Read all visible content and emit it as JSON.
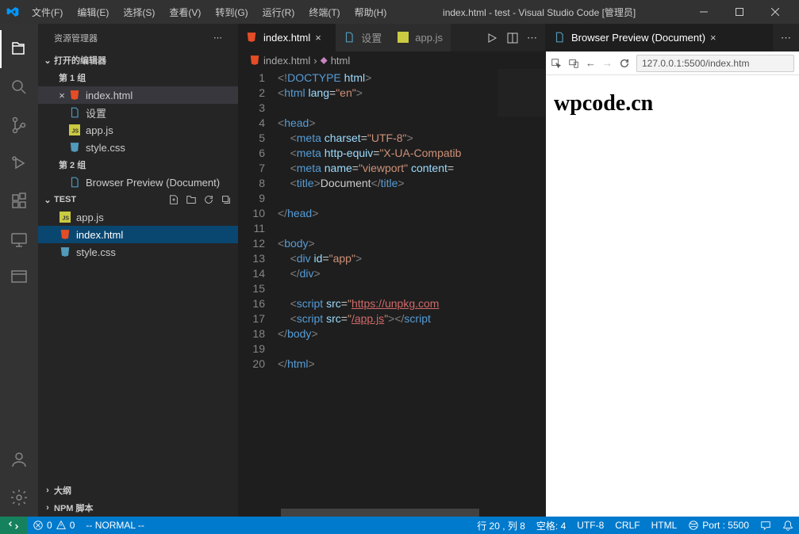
{
  "titlebar": {
    "menu": [
      "文件(F)",
      "编辑(E)",
      "选择(S)",
      "查看(V)",
      "转到(G)",
      "运行(R)",
      "终端(T)",
      "帮助(H)"
    ],
    "title": "index.html - test - Visual Studio Code [管理员]"
  },
  "sidebar": {
    "title": "资源管理器",
    "open_editors": "打开的编辑器",
    "group1": "第 1 组",
    "group2": "第 2 组",
    "files_g1": [
      {
        "name": "index.html",
        "icon": "html",
        "close": true
      },
      {
        "name": "设置",
        "icon": "file"
      },
      {
        "name": "app.js",
        "icon": "js"
      },
      {
        "name": "style.css",
        "icon": "css"
      }
    ],
    "files_g2": [
      {
        "name": "Browser Preview (Document)",
        "icon": "file"
      }
    ],
    "project": "TEST",
    "project_files": [
      {
        "name": "app.js",
        "icon": "js"
      },
      {
        "name": "index.html",
        "icon": "html",
        "selected": true
      },
      {
        "name": "style.css",
        "icon": "css"
      }
    ],
    "outline": "大纲",
    "npm": "NPM 脚本"
  },
  "tabs": {
    "t1": "index.html",
    "t2": "设置",
    "t3": "app.js",
    "preview": "Browser Preview (Document)"
  },
  "breadcrumb": {
    "file": "index.html",
    "path": "html"
  },
  "code": {
    "lines": 20,
    "l1": {
      "a": "<!",
      "b": "DOCTYPE",
      "c": " html",
      "d": ">"
    },
    "l2": {
      "a": "<",
      "b": "html",
      "c": " lang",
      "d": "=",
      "e": "\"en\"",
      "f": ">"
    },
    "l4": {
      "a": "<",
      "b": "head",
      "c": ">"
    },
    "l5": {
      "a": "<",
      "b": "meta",
      "c": " charset",
      "d": "=",
      "e": "\"UTF-8\"",
      "f": ">"
    },
    "l6": {
      "a": "<",
      "b": "meta",
      "c": " http-equiv",
      "d": "=",
      "e": "\"X-UA-Compatib"
    },
    "l7": {
      "a": "<",
      "b": "meta",
      "c": " name",
      "d": "=",
      "e": "\"viewport\"",
      "f": " content",
      "g": "="
    },
    "l8": {
      "a": "<",
      "b": "title",
      "c": ">",
      "d": "Document",
      "e": "</",
      "f": "title",
      "g": ">"
    },
    "l10": {
      "a": "</",
      "b": "head",
      "c": ">"
    },
    "l12": {
      "a": "<",
      "b": "body",
      "c": ">"
    },
    "l13": {
      "a": "<",
      "b": "div",
      "c": " id",
      "d": "=",
      "e": "\"app\"",
      "f": ">"
    },
    "l14": {
      "a": "</",
      "b": "div",
      "c": ">"
    },
    "l16": {
      "a": "<",
      "b": "script",
      "c": " src",
      "d": "=",
      "e": "\"",
      "f": "https://unpkg.com"
    },
    "l17": {
      "a": "<",
      "b": "script",
      "c": " src",
      "d": "=",
      "e": "\"",
      "f": "/app.js",
      "g": "\"",
      "h": "></",
      "i": "script"
    },
    "l18": {
      "a": "</",
      "b": "body",
      "c": ">"
    },
    "l20": {
      "a": "</",
      "b": "html",
      "c": ">"
    }
  },
  "preview": {
    "url": "127.0.0.1:5500/index.htm",
    "heading": "wpcode.cn"
  },
  "status": {
    "errors": "0",
    "warnings": "0",
    "mode": "-- NORMAL --",
    "ln_col": "行 20 , 列 8",
    "spaces": "空格: 4",
    "encoding": "UTF-8",
    "eol": "CRLF",
    "lang": "HTML",
    "port": "Port : 5500"
  }
}
